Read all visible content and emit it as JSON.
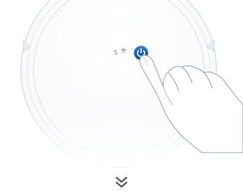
{
  "robot": {
    "spot_label": "S",
    "wifi_icon": "wifi-icon",
    "power_icon": "power-icon",
    "power_button_color": "#1660b0",
    "scroll_icon": "double-chevron-down-icon",
    "scroll_color": "#4a5560"
  }
}
